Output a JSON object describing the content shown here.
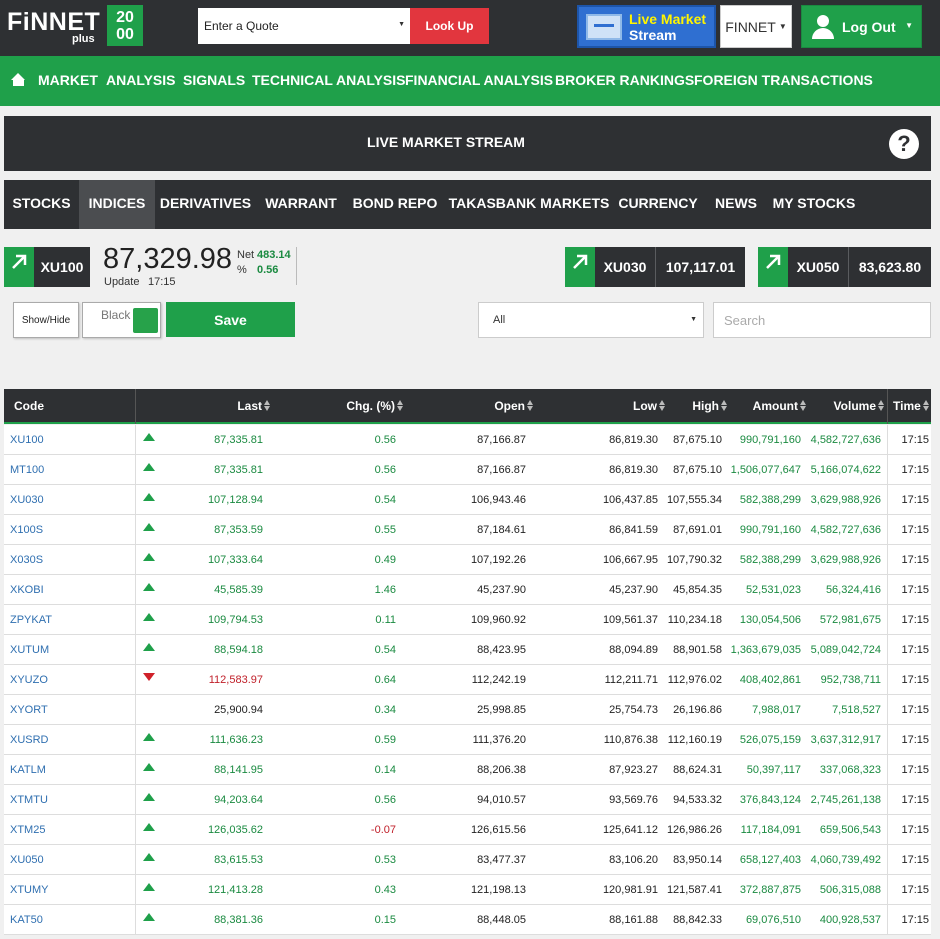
{
  "header": {
    "logo_text": "FiNNET",
    "logo_sub": "plus",
    "logo_box_top": "20",
    "logo_box_bottom": "00",
    "quote_placeholder": "Enter a Quote",
    "lookup_label": "Look Up",
    "live_line1": "Live Market",
    "live_line2": "Stream",
    "finnet_dropdown": "FINNET",
    "logout_label": "Log Out"
  },
  "nav": {
    "items": [
      "MARKET",
      "ANALYSIS",
      "SIGNALS",
      "TECHNICAL ANALYSIS",
      "FINANCIAL ANALYSIS",
      "BROKER RANKINGS",
      "FOREIGN TRANSACTIONS"
    ]
  },
  "stream": {
    "title": "LIVE MARKET STREAM",
    "help_symbol": "?"
  },
  "tabs": {
    "items": [
      "STOCKS",
      "INDICES",
      "DERIVATIVES",
      "WARRANT",
      "BOND REPO",
      "TAKASBANK MARKETS",
      "CURRENCY",
      "NEWS",
      "MY STOCKS"
    ],
    "active": "INDICES"
  },
  "summary": {
    "main_code": "XU100",
    "main_value": "87,329.98",
    "net_label": "Net",
    "net_value": "483.14",
    "pct_label": "%",
    "pct_value": "0.56",
    "update_label": "Update",
    "update_time": "17:15",
    "cards": [
      {
        "code": "XU030",
        "value": "107,117.01"
      },
      {
        "code": "XU050",
        "value": "83,623.80"
      }
    ]
  },
  "controls": {
    "showhide_label": "Show/Hide",
    "theme_label": "Black",
    "save_label": "Save",
    "filter_value": "All",
    "search_placeholder": "Search"
  },
  "colors": {
    "accent_green": "#1fa04a",
    "dark_bar": "#2e3033",
    "up": "#1a8a40",
    "down": "#c0202a",
    "link": "#2f6fb0"
  },
  "table": {
    "columns": [
      "Code",
      "Last",
      "Chg. (%)",
      "Open",
      "Low",
      "High",
      "Amount",
      "Volume",
      "Time"
    ],
    "rows": [
      {
        "code": "XU100",
        "dir": "up",
        "last": "87,335.81",
        "chg": "0.56",
        "chg_dir": "up",
        "open": "87,166.87",
        "low": "86,819.30",
        "high": "87,675.10",
        "amount": "990,791,160",
        "volume": "4,582,727,636",
        "time": "17:15"
      },
      {
        "code": "MT100",
        "dir": "up",
        "last": "87,335.81",
        "chg": "0.56",
        "chg_dir": "up",
        "open": "87,166.87",
        "low": "86,819.30",
        "high": "87,675.10",
        "amount": "1,506,077,647",
        "volume": "5,166,074,622",
        "time": "17:15"
      },
      {
        "code": "XU030",
        "dir": "up",
        "last": "107,128.94",
        "chg": "0.54",
        "chg_dir": "up",
        "open": "106,943.46",
        "low": "106,437.85",
        "high": "107,555.34",
        "amount": "582,388,299",
        "volume": "3,629,988,926",
        "time": "17:15"
      },
      {
        "code": "X100S",
        "dir": "up",
        "last": "87,353.59",
        "chg": "0.55",
        "chg_dir": "up",
        "open": "87,184.61",
        "low": "86,841.59",
        "high": "87,691.01",
        "amount": "990,791,160",
        "volume": "4,582,727,636",
        "time": "17:15"
      },
      {
        "code": "X030S",
        "dir": "up",
        "last": "107,333.64",
        "chg": "0.49",
        "chg_dir": "up",
        "open": "107,192.26",
        "low": "106,667.95",
        "high": "107,790.32",
        "amount": "582,388,299",
        "volume": "3,629,988,926",
        "time": "17:15"
      },
      {
        "code": "XKOBI",
        "dir": "up",
        "last": "45,585.39",
        "chg": "1.46",
        "chg_dir": "up",
        "open": "45,237.90",
        "low": "45,237.90",
        "high": "45,854.35",
        "amount": "52,531,023",
        "volume": "56,324,416",
        "time": "17:15"
      },
      {
        "code": "ZPYKAT",
        "dir": "up",
        "last": "109,794.53",
        "chg": "0.11",
        "chg_dir": "up",
        "open": "109,960.92",
        "low": "109,561.37",
        "high": "110,234.18",
        "amount": "130,054,506",
        "volume": "572,981,675",
        "time": "17:15"
      },
      {
        "code": "XUTUM",
        "dir": "up",
        "last": "88,594.18",
        "chg": "0.54",
        "chg_dir": "up",
        "open": "88,423.95",
        "low": "88,094.89",
        "high": "88,901.58",
        "amount": "1,363,679,035",
        "volume": "5,089,042,724",
        "time": "17:15"
      },
      {
        "code": "XYUZO",
        "dir": "down",
        "last": "112,583.97",
        "chg": "0.64",
        "chg_dir": "up",
        "open": "112,242.19",
        "low": "112,211.71",
        "high": "112,976.02",
        "amount": "408,402,861",
        "volume": "952,738,711",
        "time": "17:15"
      },
      {
        "code": "XYORT",
        "dir": "none",
        "last": "25,900.94",
        "chg": "0.34",
        "chg_dir": "up",
        "open": "25,998.85",
        "low": "25,754.73",
        "high": "26,196.86",
        "amount": "7,988,017",
        "volume": "7,518,527",
        "time": "17:15"
      },
      {
        "code": "XUSRD",
        "dir": "up",
        "last": "111,636.23",
        "chg": "0.59",
        "chg_dir": "up",
        "open": "111,376.20",
        "low": "110,876.38",
        "high": "112,160.19",
        "amount": "526,075,159",
        "volume": "3,637,312,917",
        "time": "17:15"
      },
      {
        "code": "KATLM",
        "dir": "up",
        "last": "88,141.95",
        "chg": "0.14",
        "chg_dir": "up",
        "open": "88,206.38",
        "low": "87,923.27",
        "high": "88,624.31",
        "amount": "50,397,117",
        "volume": "337,068,323",
        "time": "17:15"
      },
      {
        "code": "XTMTU",
        "dir": "up",
        "last": "94,203.64",
        "chg": "0.56",
        "chg_dir": "up",
        "open": "94,010.57",
        "low": "93,569.76",
        "high": "94,533.32",
        "amount": "376,843,124",
        "volume": "2,745,261,138",
        "time": "17:15"
      },
      {
        "code": "XTM25",
        "dir": "up",
        "last": "126,035.62",
        "chg": "-0.07",
        "chg_dir": "down",
        "open": "126,615.56",
        "low": "125,641.12",
        "high": "126,986.26",
        "amount": "117,184,091",
        "volume": "659,506,543",
        "time": "17:15"
      },
      {
        "code": "XU050",
        "dir": "up",
        "last": "83,615.53",
        "chg": "0.53",
        "chg_dir": "up",
        "open": "83,477.37",
        "low": "83,106.20",
        "high": "83,950.14",
        "amount": "658,127,403",
        "volume": "4,060,739,492",
        "time": "17:15"
      },
      {
        "code": "XTUMY",
        "dir": "up",
        "last": "121,413.28",
        "chg": "0.43",
        "chg_dir": "up",
        "open": "121,198.13",
        "low": "120,981.91",
        "high": "121,587.41",
        "amount": "372,887,875",
        "volume": "506,315,088",
        "time": "17:15"
      },
      {
        "code": "KAT50",
        "dir": "up",
        "last": "88,381.36",
        "chg": "0.15",
        "chg_dir": "up",
        "open": "88,448.05",
        "low": "88,161.88",
        "high": "88,842.33",
        "amount": "69,076,510",
        "volume": "400,928,537",
        "time": "17:15"
      }
    ]
  }
}
